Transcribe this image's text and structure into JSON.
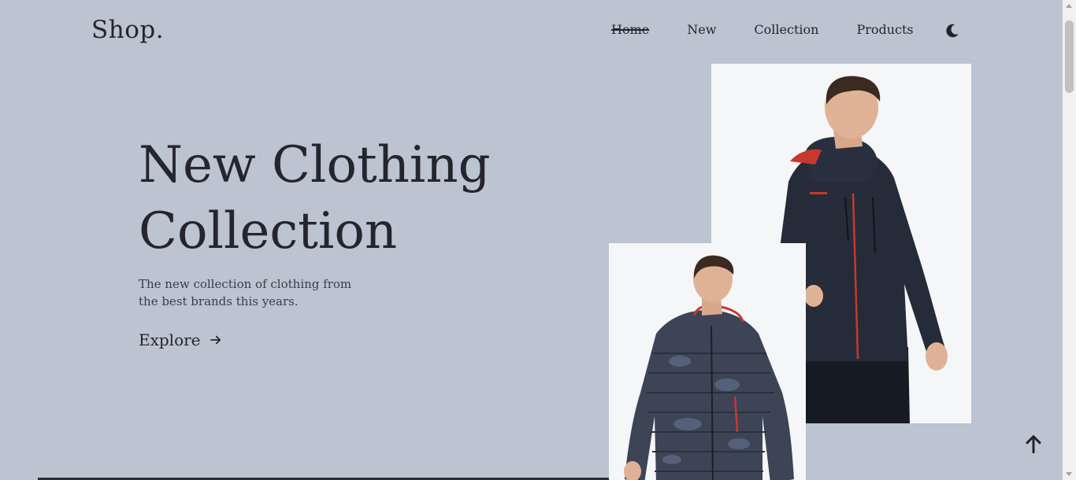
{
  "header": {
    "logo": "Shop.",
    "nav": [
      "Home",
      "New",
      "Collection",
      "Products"
    ],
    "active_nav": "Home",
    "theme_icon": "moon-icon"
  },
  "hero": {
    "title_line1": "New Clothing",
    "title_line2": "Collection",
    "description": "The new collection of clothing from the best brands this years.",
    "cta_label": "Explore",
    "cta_icon": "arrow-right-icon"
  },
  "images": {
    "large": "man in navy hooded jacket",
    "small": "man in camouflage puffer jacket"
  },
  "scroll_top_icon": "arrow-up-icon",
  "colors": {
    "background": "#bcc3d1",
    "text": "#23262d",
    "image_bg": "#f4f6f8",
    "accent_red": "#c8382c"
  }
}
